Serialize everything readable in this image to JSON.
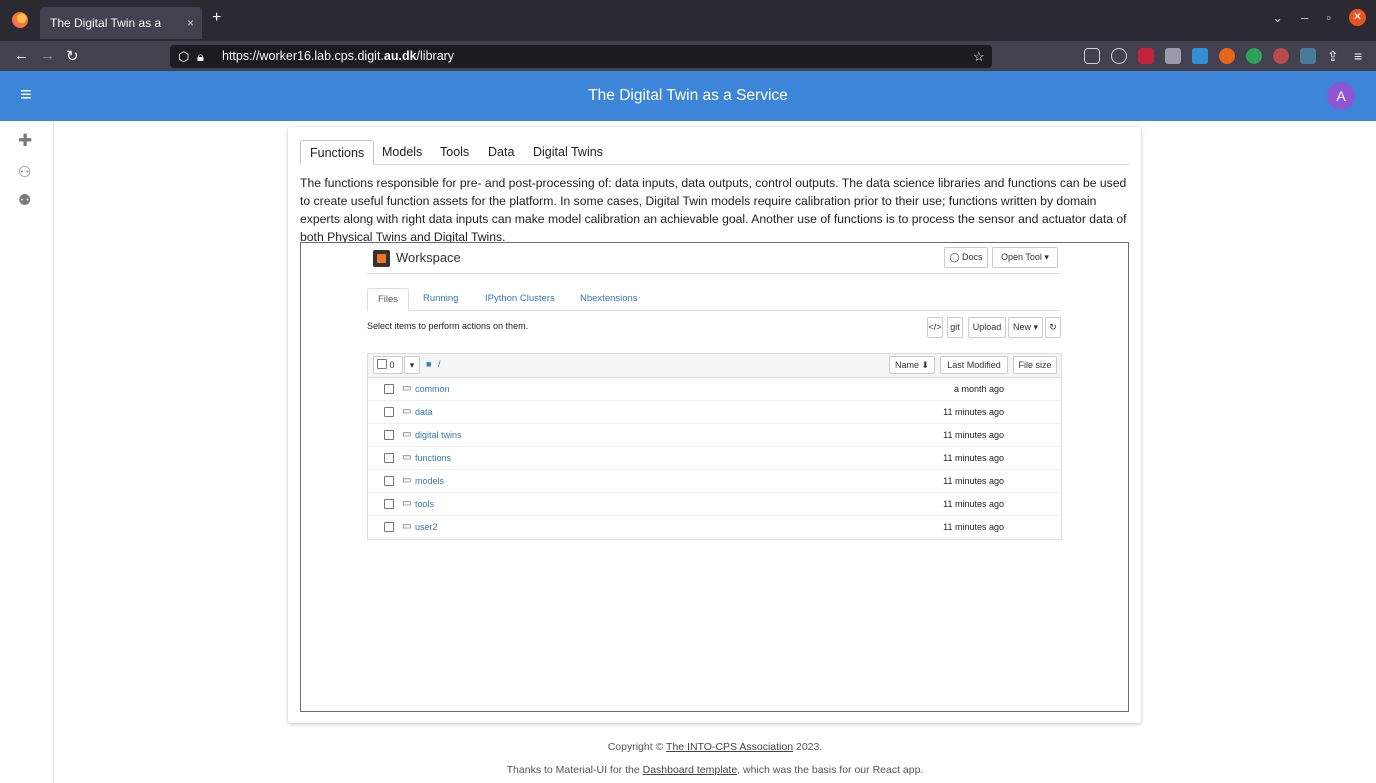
{
  "browser": {
    "tab_title": "The Digital Twin as a Service",
    "tab_close": "×",
    "new_tab": "+",
    "url_prefix": "https://worker16.lab.cps.digit.",
    "url_host": "au.dk",
    "url_suffix": "/library"
  },
  "app": {
    "title": "The Digital Twin as a Service",
    "avatar_letter": "A"
  },
  "tabs": [
    "Functions",
    "Models",
    "Tools",
    "Data",
    "Digital Twins"
  ],
  "description": "The functions responsible for pre- and post-processing of: data inputs, data outputs, control outputs. The data science libraries and functions can be used to create useful function assets for the platform. In some cases, Digital Twin models require calibration prior to their use; functions written by domain experts along with right data inputs can make model calibration an achievable goal. Another use of functions is to process the sensor and actuator data of both Physical Twins and Digital Twins.",
  "jupyter": {
    "title": "Workspace",
    "docs_btn": "Docs",
    "open_tool_btn": "Open Tool ▾",
    "tabs": [
      "Files",
      "Running",
      "IPython Clusters",
      "Nbextensions"
    ],
    "select_text": "Select items to perform actions on them.",
    "code_btn": "</>",
    "git_btn": "git",
    "upload_btn": "Upload",
    "new_btn": "New ▾",
    "refresh_btn": "↻",
    "select_count": "0",
    "path": "/",
    "col_name": "Name ⬇",
    "col_modified": "Last Modified",
    "col_size": "File size",
    "rows": [
      {
        "name": "common",
        "modified": "a month ago"
      },
      {
        "name": "data",
        "modified": "11 minutes ago"
      },
      {
        "name": "digital twins",
        "modified": "11 minutes ago"
      },
      {
        "name": "functions",
        "modified": "11 minutes ago"
      },
      {
        "name": "models",
        "modified": "11 minutes ago"
      },
      {
        "name": "tools",
        "modified": "11 minutes ago"
      },
      {
        "name": "user2",
        "modified": "11 minutes ago"
      }
    ]
  },
  "footer": {
    "copy_prefix": "Copyright © ",
    "copy_link": "The INTO-CPS Association",
    "copy_suffix": " 2023.",
    "thanks_prefix": "Thanks to Material-UI for the ",
    "thanks_link": "Dashboard template",
    "thanks_suffix": ", which was the basis for our React app."
  }
}
